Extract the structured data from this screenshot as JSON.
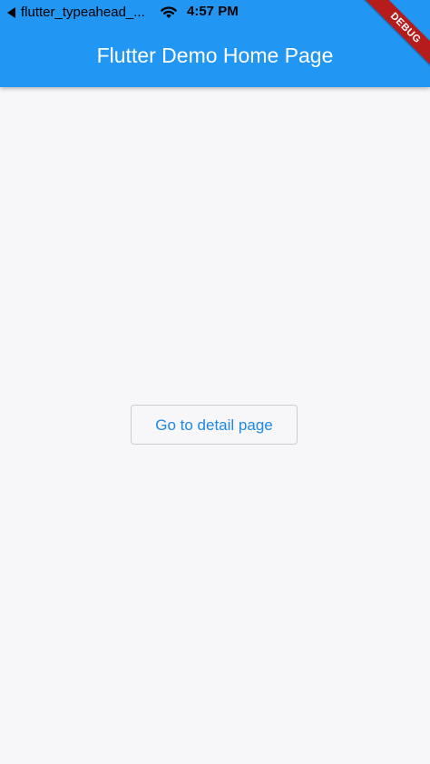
{
  "status_bar": {
    "app": "flutter_typeahead_...",
    "time": "4:57 PM",
    "back_icon": "back-caret-icon",
    "wifi_icon": "wifi-icon"
  },
  "appbar": {
    "title": "Flutter Demo Home Page",
    "background": "#2196F3"
  },
  "ribbon": {
    "label": "DEBUG",
    "color": "#B71C1C"
  },
  "main": {
    "button_label": "Go to detail page",
    "button_color": "#1E88E5"
  }
}
